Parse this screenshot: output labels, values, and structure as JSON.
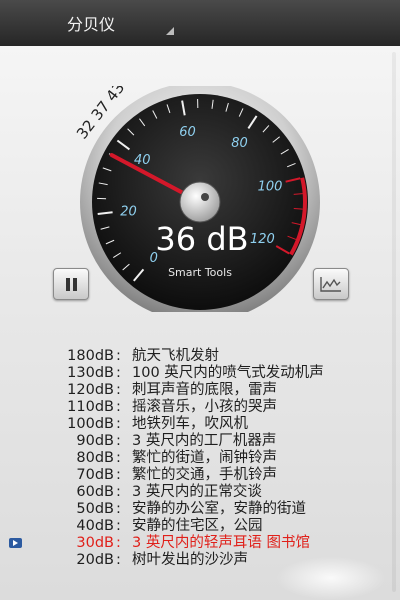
{
  "app": {
    "title": "分贝仪"
  },
  "gauge": {
    "scale_labels": [
      "0",
      "20",
      "40",
      "60",
      "80",
      "100",
      "120"
    ],
    "recent_peaks": "32 37 43",
    "value_text": "36 dB",
    "brand": "Smart Tools",
    "needle_value_db": 36,
    "scale_max_db": 120
  },
  "controls": {
    "pause_icon": "pause-icon",
    "chart_icon": "line-chart-icon"
  },
  "levels": [
    {
      "db": "180dB",
      "sep": ":",
      "desc": "航天飞机发射"
    },
    {
      "db": "130dB",
      "sep": ":",
      "desc": "100 英尺内的喷气式发动机声"
    },
    {
      "db": "120dB",
      "sep": ":",
      "desc": "刺耳声音的底限，雷声"
    },
    {
      "db": "110dB",
      "sep": ":",
      "desc": "摇滚音乐，小孩的哭声"
    },
    {
      "db": "100dB",
      "sep": ":",
      "desc": "地铁列车，吹风机"
    },
    {
      "db": "90dB",
      "sep": ":",
      "desc": "3 英尺内的工厂机器声"
    },
    {
      "db": "80dB",
      "sep": ":",
      "desc": "繁忙的街道，闹钟铃声"
    },
    {
      "db": "70dB",
      "sep": ":",
      "desc": "繁忙的交通，手机铃声"
    },
    {
      "db": "60dB",
      "sep": ":",
      "desc": "3 英尺内的正常交谈"
    },
    {
      "db": "50dB",
      "sep": ":",
      "desc": "安静的办公室，安静的街道"
    },
    {
      "db": "40dB",
      "sep": ":",
      "desc": "安静的住宅区，公园"
    },
    {
      "db": "30dB",
      "sep": ":",
      "desc": "3 英尺内的轻声耳语 图书馆",
      "current": true
    },
    {
      "db": "20dB",
      "sep": ":",
      "desc": "树叶发出的沙沙声"
    }
  ],
  "colors": {
    "current_level": "#e0201a",
    "scale_text": "#8fd0ef",
    "needle": "#d4182a"
  }
}
